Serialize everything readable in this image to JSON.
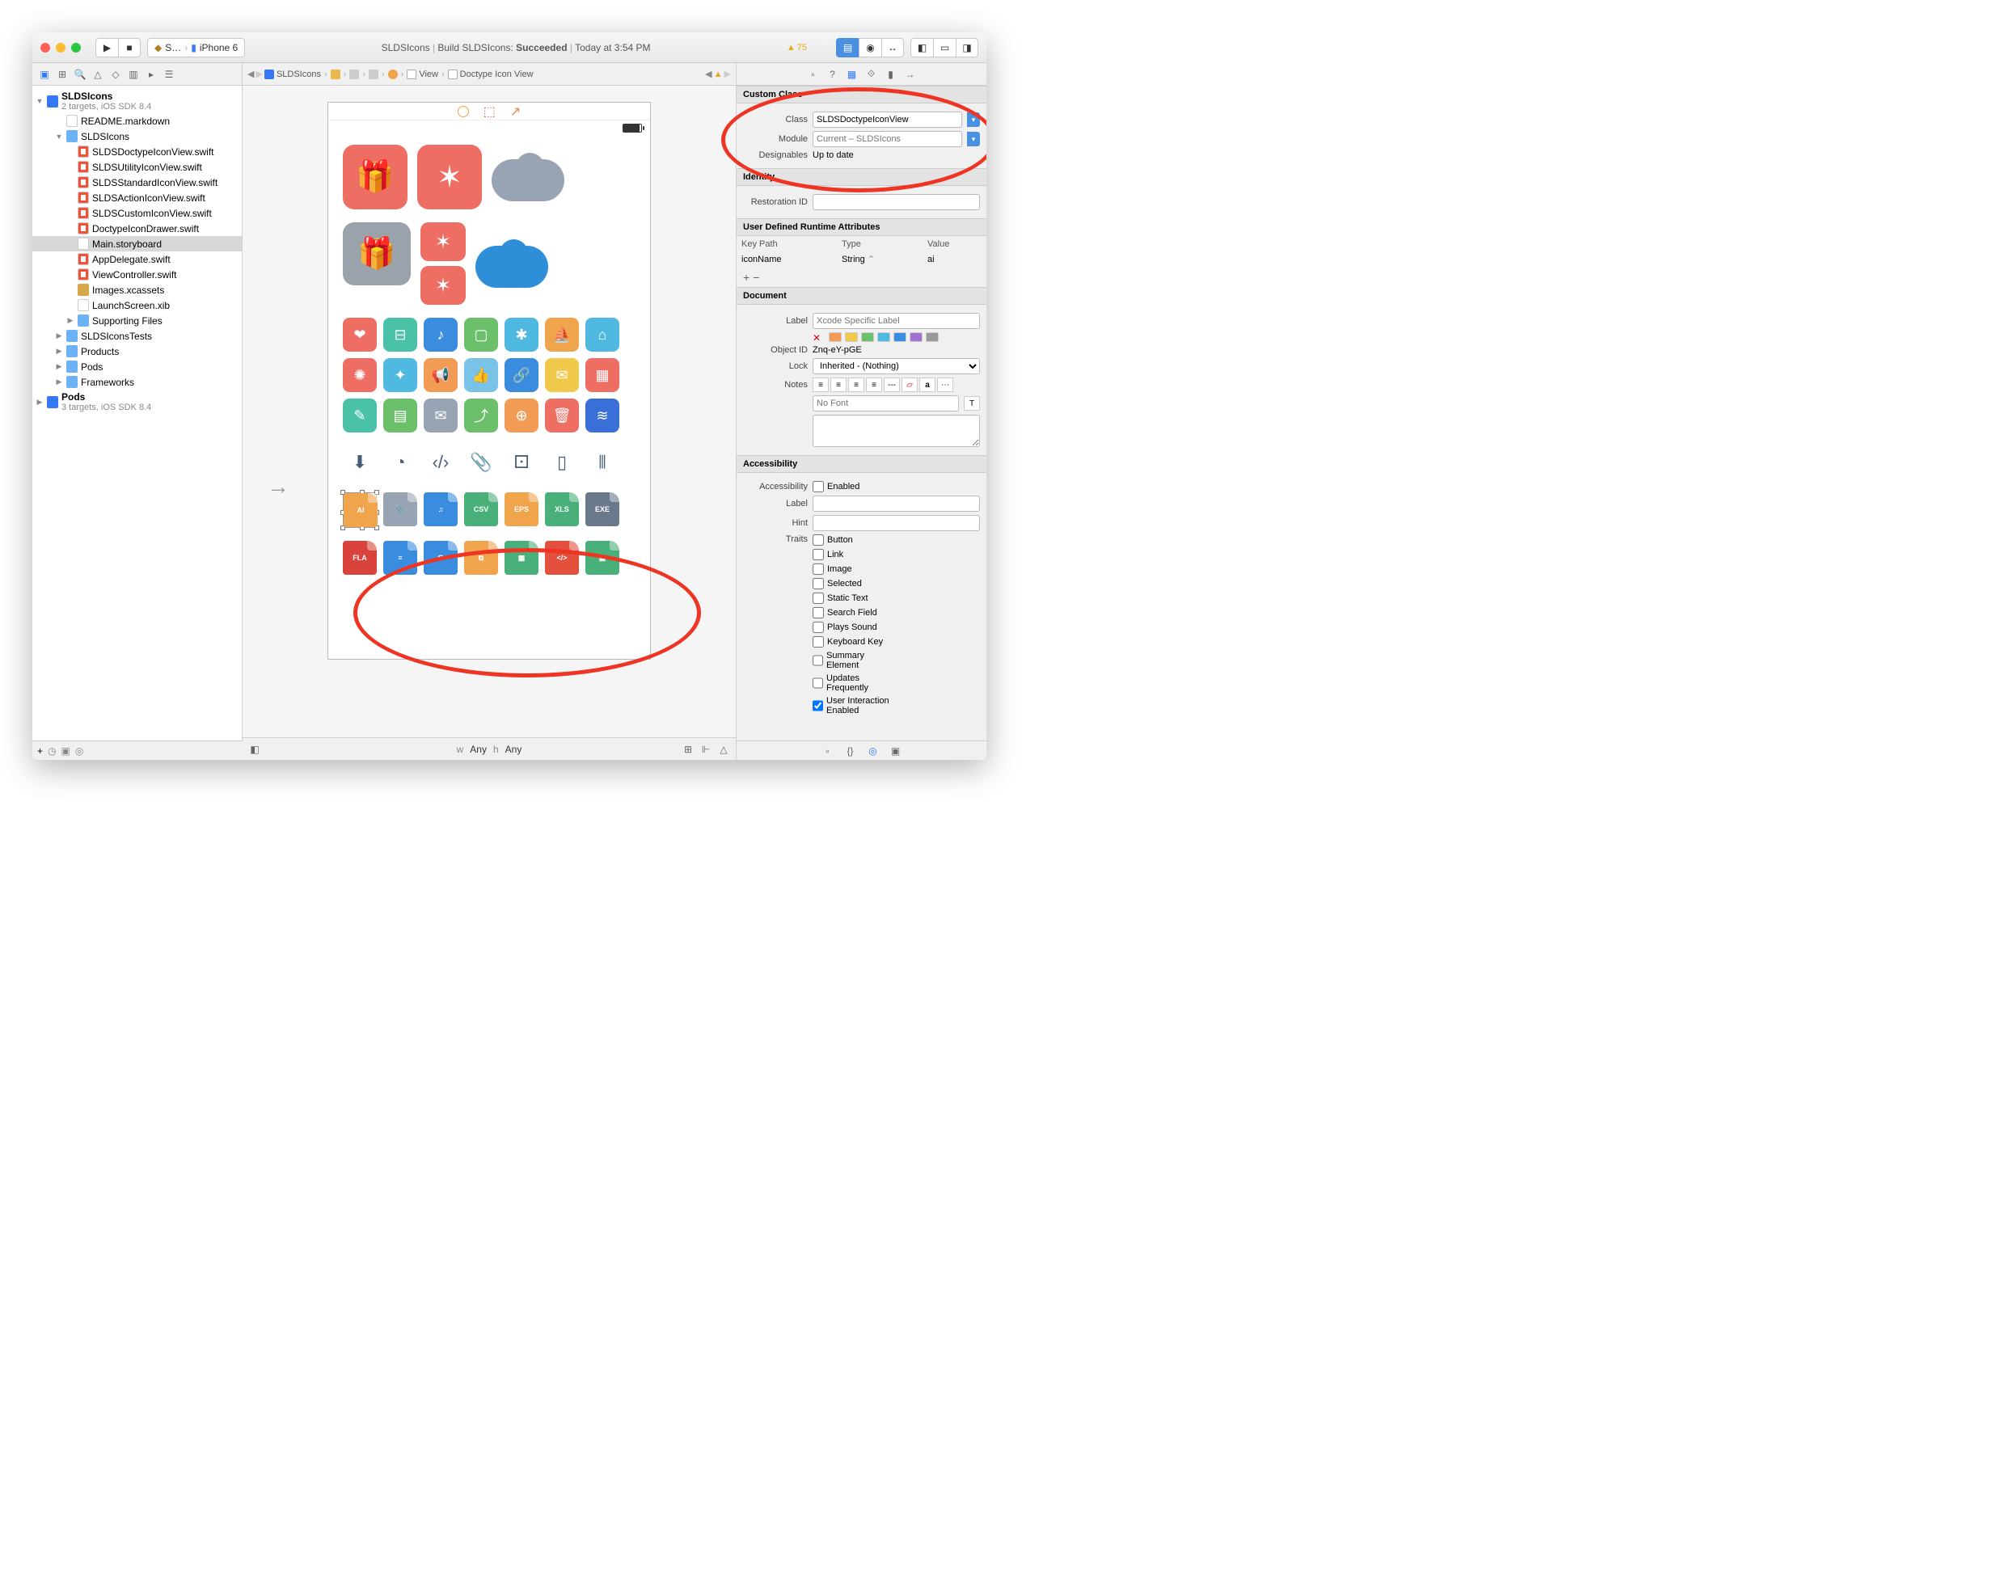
{
  "titlebar": {
    "scheme_app": "S…",
    "scheme_device": "iPhone 6",
    "status_project": "SLDSIcons",
    "status_text": "Build SLDSIcons:",
    "status_result": "Succeeded",
    "status_time": "Today at 3:54 PM",
    "warnings": "75"
  },
  "breadcrumb": [
    "SLDSIcons",
    "",
    "",
    "",
    "",
    "View",
    "Doctype Icon View"
  ],
  "sidebar": {
    "project": "SLDSIcons",
    "project_sub": "2 targets, iOS SDK 8.4",
    "items": [
      {
        "label": "README.markdown",
        "icon": "doc",
        "indent": 2
      },
      {
        "label": "SLDSIcons",
        "icon": "folder",
        "indent": 2,
        "disclose": "▼"
      },
      {
        "label": "SLDSDoctypeIconView.swift",
        "icon": "swift",
        "indent": 3
      },
      {
        "label": "SLDSUtilityIconView.swift",
        "icon": "swift",
        "indent": 3
      },
      {
        "label": "SLDSStandardIconView.swift",
        "icon": "swift",
        "indent": 3
      },
      {
        "label": "SLDSActionIconView.swift",
        "icon": "swift",
        "indent": 3
      },
      {
        "label": "SLDSCustomIconView.swift",
        "icon": "swift",
        "indent": 3
      },
      {
        "label": "DoctypeIconDrawer.swift",
        "icon": "swift",
        "indent": 3
      },
      {
        "label": "Main.storyboard",
        "icon": "sb",
        "indent": 3,
        "sel": true
      },
      {
        "label": "AppDelegate.swift",
        "icon": "swift",
        "indent": 3
      },
      {
        "label": "ViewController.swift",
        "icon": "swift",
        "indent": 3
      },
      {
        "label": "Images.xcassets",
        "icon": "yellow",
        "indent": 3
      },
      {
        "label": "LaunchScreen.xib",
        "icon": "xib",
        "indent": 3
      },
      {
        "label": "Supporting Files",
        "icon": "folder",
        "indent": 3,
        "disclose": "▶"
      },
      {
        "label": "SLDSIconsTests",
        "icon": "folder",
        "indent": 2,
        "disclose": "▶"
      },
      {
        "label": "Products",
        "icon": "folder",
        "indent": 2,
        "disclose": "▶"
      },
      {
        "label": "Pods",
        "icon": "folder",
        "indent": 2,
        "disclose": "▶"
      },
      {
        "label": "Frameworks",
        "icon": "folder",
        "indent": 2,
        "disclose": "▶"
      }
    ],
    "pods_project": "Pods",
    "pods_sub": "3 targets, iOS SDK 8.4"
  },
  "canvas": {
    "size_w_label": "w",
    "size_w": "Any",
    "size_h_label": "h",
    "size_h": "Any",
    "action_icons": [
      {
        "g": "❤",
        "c": "#ef6e64"
      },
      {
        "g": "⊟",
        "c": "#49c2a8"
      },
      {
        "g": "♪",
        "c": "#3a8dde"
      },
      {
        "g": "▢",
        "c": "#6cc06c"
      },
      {
        "g": "✱",
        "c": "#4fb9e1"
      },
      {
        "g": "⛵",
        "c": "#f0a44b"
      },
      {
        "g": "⌂",
        "c": "#4fb9e1"
      },
      {
        "g": "✺",
        "c": "#ef6e64"
      },
      {
        "g": "✦",
        "c": "#4fb9e1"
      },
      {
        "g": "📢",
        "c": "#f29b54"
      },
      {
        "g": "👍",
        "c": "#7ac3e8"
      },
      {
        "g": "🔗",
        "c": "#3a8dde"
      },
      {
        "g": "✉",
        "c": "#f0c94b"
      },
      {
        "g": "▦",
        "c": "#ef6e64"
      },
      {
        "g": "✎",
        "c": "#49c2a8"
      },
      {
        "g": "▤",
        "c": "#6cc06c"
      },
      {
        "g": "✉",
        "c": "#98a4b3"
      },
      {
        "g": "⤴",
        "c": "#6cc06c"
      },
      {
        "g": "⊕",
        "c": "#f29b54"
      },
      {
        "g": "🗑",
        "c": "#ef6e64"
      },
      {
        "g": "≋",
        "c": "#3a6fd8"
      }
    ],
    "plain_icons": [
      "⬇",
      "◔",
      "‹/›",
      "📎",
      "⚀",
      "▯",
      "⫴"
    ],
    "doctype_row1": [
      {
        "t": "AI",
        "c": "#f0a44b",
        "sel": true
      },
      {
        "t": "📎",
        "c": "#98a4b3"
      },
      {
        "t": "♫",
        "c": "#3a8dde"
      },
      {
        "t": "CSV",
        "c": "#49b07a"
      },
      {
        "t": "EPS",
        "c": "#f0a44b"
      },
      {
        "t": "XLS",
        "c": "#49b07a"
      },
      {
        "t": "EXE",
        "c": "#6a7a8c"
      }
    ],
    "doctype_row2": [
      {
        "t": "FLA",
        "c": "#d9433b"
      },
      {
        "t": "≡",
        "c": "#3a8dde"
      },
      {
        "t": "G",
        "c": "#3a8dde"
      },
      {
        "t": "⧉",
        "c": "#f0a44b"
      },
      {
        "t": "▦",
        "c": "#49b07a"
      },
      {
        "t": "</>",
        "c": "#e3503e"
      },
      {
        "t": "▣",
        "c": "#49b07a"
      }
    ]
  },
  "inspector": {
    "custom_class": {
      "title": "Custom Class",
      "class_label": "Class",
      "class_value": "SLDSDoctypeIconView",
      "module_label": "Module",
      "module_placeholder": "Current – SLDSIcons",
      "designables_label": "Designables",
      "designables_value": "Up to date"
    },
    "identity": {
      "title": "Identity",
      "restoration_label": "Restoration ID"
    },
    "runtime_attrs": {
      "title": "User Defined Runtime Attributes",
      "headers": [
        "Key Path",
        "Type",
        "Value"
      ],
      "row": {
        "keypath": "iconName",
        "type": "String",
        "value": "ai"
      }
    },
    "document": {
      "title": "Document",
      "label_label": "Label",
      "label_placeholder": "Xcode Specific Label",
      "objectid_label": "Object ID",
      "objectid_value": "Znq-eY-pGE",
      "lock_label": "Lock",
      "lock_value": "Inherited - (Nothing)",
      "notes_label": "Notes",
      "nofont": "No Font"
    },
    "accessibility": {
      "title": "Accessibility",
      "access_label": "Accessibility",
      "enabled_label": "Enabled",
      "label_label": "Label",
      "hint_label": "Hint",
      "traits_label": "Traits",
      "traits": [
        "Button",
        "Link",
        "Image",
        "Selected",
        "Static Text",
        "Search Field",
        "Plays Sound",
        "Keyboard Key",
        "Summary Element",
        "Updates Frequently",
        "User Interaction Enabled"
      ],
      "traits_checked": [
        "User Interaction Enabled"
      ]
    }
  }
}
